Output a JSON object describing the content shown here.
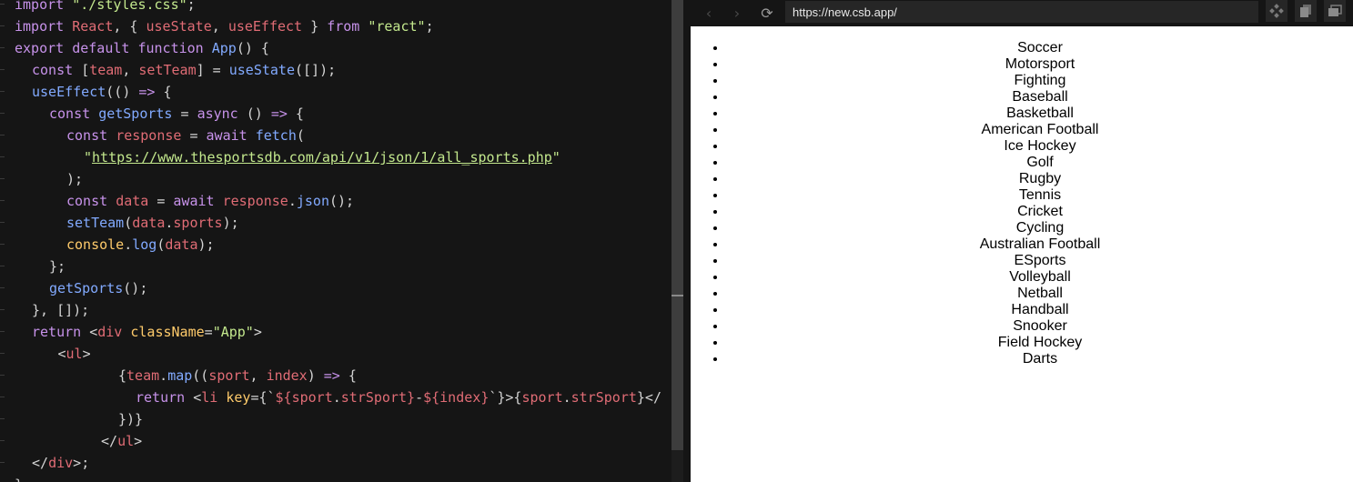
{
  "editor": {
    "lines": [
      {
        "indent": 0,
        "tokens": [
          [
            "kw",
            "import "
          ],
          [
            "str",
            "\"./styles.css\""
          ],
          [
            "punc",
            ";"
          ]
        ]
      },
      {
        "indent": 0,
        "tokens": [
          [
            "kw",
            "import "
          ],
          [
            "var",
            "React"
          ],
          [
            "punc",
            ", { "
          ],
          [
            "var",
            "useState"
          ],
          [
            "punc",
            ", "
          ],
          [
            "var",
            "useEffect"
          ],
          [
            "punc",
            " } "
          ],
          [
            "kw",
            "from "
          ],
          [
            "str",
            "\"react\""
          ],
          [
            "punc",
            ";"
          ]
        ]
      },
      {
        "indent": 0,
        "tokens": [
          [
            "kw",
            "export default function "
          ],
          [
            "fn",
            "App"
          ],
          [
            "punc",
            "() {"
          ]
        ]
      },
      {
        "indent": 2,
        "tokens": [
          [
            "kw",
            "const "
          ],
          [
            "punc",
            "["
          ],
          [
            "var",
            "team"
          ],
          [
            "punc",
            ", "
          ],
          [
            "var",
            "setTeam"
          ],
          [
            "punc",
            "] = "
          ],
          [
            "fn",
            "useState"
          ],
          [
            "punc",
            "([]);"
          ]
        ]
      },
      {
        "indent": 2,
        "tokens": [
          [
            "fn",
            "useEffect"
          ],
          [
            "punc",
            "(() "
          ],
          [
            "kw",
            "=>"
          ],
          [
            "punc",
            " {"
          ]
        ]
      },
      {
        "indent": 4,
        "tokens": [
          [
            "kw",
            "const "
          ],
          [
            "fn",
            "getSports"
          ],
          [
            "punc",
            " = "
          ],
          [
            "kw",
            "async "
          ],
          [
            "punc",
            "() "
          ],
          [
            "kw",
            "=>"
          ],
          [
            "punc",
            " {"
          ]
        ]
      },
      {
        "indent": 6,
        "tokens": [
          [
            "kw",
            "const "
          ],
          [
            "var",
            "response"
          ],
          [
            "punc",
            " = "
          ],
          [
            "kw",
            "await "
          ],
          [
            "fn",
            "fetch"
          ],
          [
            "punc",
            "("
          ]
        ]
      },
      {
        "indent": 8,
        "tokens": [
          [
            "str",
            "\""
          ],
          [
            "url",
            "https://www.thesportsdb.com/api/v1/json/1/all_sports.php"
          ],
          [
            "str",
            "\""
          ]
        ]
      },
      {
        "indent": 6,
        "tokens": [
          [
            "punc",
            ");"
          ]
        ]
      },
      {
        "indent": 6,
        "tokens": [
          [
            "kw",
            "const "
          ],
          [
            "var",
            "data"
          ],
          [
            "punc",
            " = "
          ],
          [
            "kw",
            "await "
          ],
          [
            "var",
            "response"
          ],
          [
            "punc",
            "."
          ],
          [
            "fn",
            "json"
          ],
          [
            "punc",
            "();"
          ]
        ]
      },
      {
        "indent": 6,
        "tokens": [
          [
            "fn",
            "setTeam"
          ],
          [
            "punc",
            "("
          ],
          [
            "var",
            "data"
          ],
          [
            "punc",
            "."
          ],
          [
            "var",
            "sports"
          ],
          [
            "punc",
            ");"
          ]
        ]
      },
      {
        "indent": 6,
        "tokens": [
          [
            "gold",
            "console"
          ],
          [
            "punc",
            "."
          ],
          [
            "fn",
            "log"
          ],
          [
            "punc",
            "("
          ],
          [
            "var",
            "data"
          ],
          [
            "punc",
            ");"
          ]
        ]
      },
      {
        "indent": 4,
        "tokens": [
          [
            "punc",
            "};"
          ]
        ]
      },
      {
        "indent": 4,
        "tokens": [
          [
            "fn",
            "getSports"
          ],
          [
            "punc",
            "();"
          ]
        ]
      },
      {
        "indent": 2,
        "tokens": [
          [
            "punc",
            "}, []);"
          ]
        ]
      },
      {
        "indent": 2,
        "tokens": [
          [
            "kw",
            "return "
          ],
          [
            "tag",
            "<"
          ],
          [
            "tagname",
            "div"
          ],
          [
            "punc",
            " "
          ],
          [
            "attr",
            "className"
          ],
          [
            "punc",
            "="
          ],
          [
            "str",
            "\"App\""
          ],
          [
            "tag",
            ">"
          ]
        ]
      },
      {
        "indent": 5,
        "tokens": [
          [
            "tag",
            "<"
          ],
          [
            "tagname",
            "ul"
          ],
          [
            "tag",
            ">"
          ]
        ]
      },
      {
        "indent": 12,
        "tokens": [
          [
            "punc",
            "{"
          ],
          [
            "var",
            "team"
          ],
          [
            "punc",
            "."
          ],
          [
            "fn",
            "map"
          ],
          [
            "punc",
            "(("
          ],
          [
            "var",
            "sport"
          ],
          [
            "punc",
            ", "
          ],
          [
            "var",
            "index"
          ],
          [
            "punc",
            ") "
          ],
          [
            "kw",
            "=>"
          ],
          [
            "punc",
            " {"
          ]
        ]
      },
      {
        "indent": 14,
        "tokens": [
          [
            "kw",
            "return "
          ],
          [
            "tag",
            "<"
          ],
          [
            "tagname",
            "li"
          ],
          [
            "punc",
            " "
          ],
          [
            "attr",
            "key"
          ],
          [
            "punc",
            "={`"
          ],
          [
            "tpl",
            "${"
          ],
          [
            "var",
            "sport"
          ],
          [
            "punc",
            "."
          ],
          [
            "var",
            "strSport"
          ],
          [
            "tpl",
            "}"
          ],
          [
            "punc",
            "-"
          ],
          [
            "tpl",
            "${"
          ],
          [
            "var",
            "index"
          ],
          [
            "tpl",
            "}"
          ],
          [
            "punc",
            "`}>{"
          ],
          [
            "var",
            "sport"
          ],
          [
            "punc",
            "."
          ],
          [
            "var",
            "strSport"
          ],
          [
            "punc",
            "}</"
          ]
        ]
      },
      {
        "indent": 12,
        "tokens": [
          [
            "punc",
            "})}"
          ]
        ]
      },
      {
        "indent": 10,
        "tokens": [
          [
            "tag",
            "</"
          ],
          [
            "tagname",
            "ul"
          ],
          [
            "tag",
            ">"
          ]
        ]
      },
      {
        "indent": 2,
        "tokens": [
          [
            "tag",
            "</"
          ],
          [
            "tagname",
            "div"
          ],
          [
            "tag",
            ">"
          ],
          [
            "punc",
            ";"
          ]
        ]
      },
      {
        "indent": 0,
        "tokens": [
          [
            "punc",
            "}"
          ]
        ]
      }
    ]
  },
  "browser": {
    "address_url": "https://new.csb.app/",
    "back_glyph": "‹",
    "forward_glyph": "›",
    "reload_glyph": "⟳",
    "icons": [
      "back-icon",
      "forward-icon",
      "reload-icon",
      "devtools-icon",
      "open-new-window-icon",
      "screen-icon"
    ]
  },
  "preview": {
    "sports": [
      "Soccer",
      "Motorsport",
      "Fighting",
      "Baseball",
      "Basketball",
      "American Football",
      "Ice Hockey",
      "Golf",
      "Rugby",
      "Tennis",
      "Cricket",
      "Cycling",
      "Australian Football",
      "ESports",
      "Volleyball",
      "Netball",
      "Handball",
      "Snooker",
      "Field Hockey",
      "Darts"
    ]
  },
  "colors": {
    "editor_bg": "#151515",
    "keyword": "#c792ea",
    "function": "#82aaff",
    "variable": "#e06c75",
    "string": "#c3e88d",
    "attribute": "#ffcb6b",
    "preview_bg": "#ffffff"
  }
}
